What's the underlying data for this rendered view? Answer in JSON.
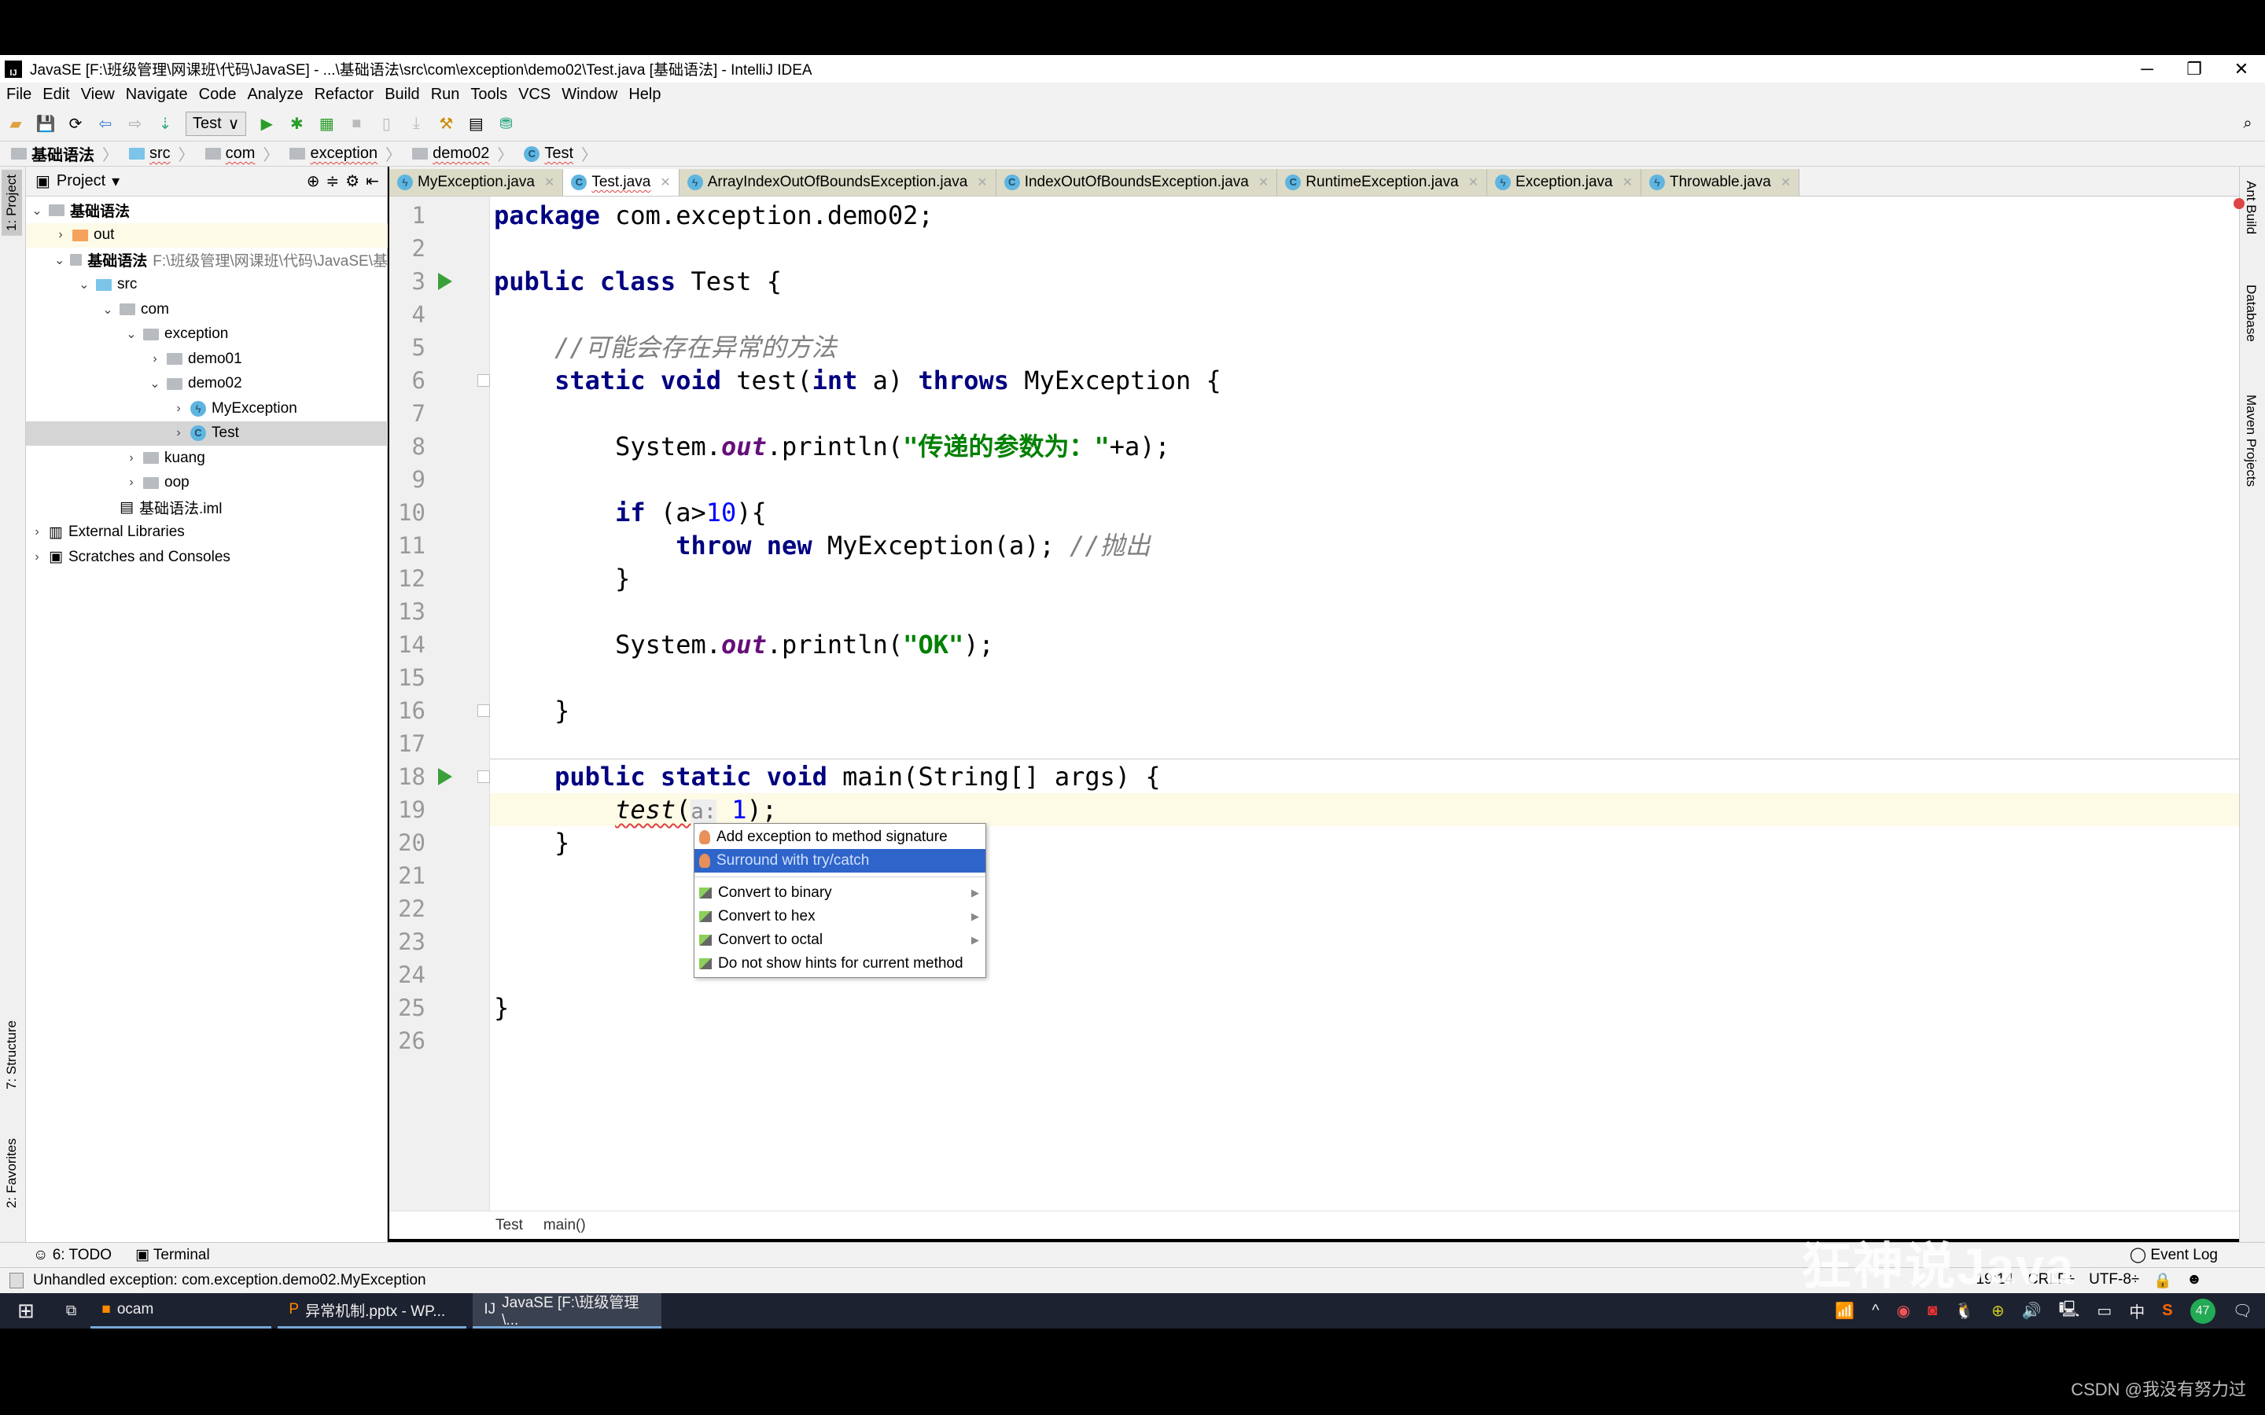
{
  "window": {
    "title": "JavaSE [F:\\班级管理\\网课班\\代码\\JavaSE] - ...\\基础语法\\src\\com\\exception\\demo02\\Test.java [基础语法] - IntelliJ IDEA",
    "logo": "IJ"
  },
  "menu": [
    "File",
    "Edit",
    "View",
    "Navigate",
    "Code",
    "Analyze",
    "Refactor",
    "Build",
    "Run",
    "Tools",
    "VCS",
    "Window",
    "Help"
  ],
  "toolbar": {
    "run_config": "Test"
  },
  "breadcrumbs": [
    "基础语法",
    "src",
    "com",
    "exception",
    "demo02",
    "Test"
  ],
  "left_strip": {
    "project": "1: Project",
    "structure": "7: Structure",
    "favorites": "2: Favorites"
  },
  "project": {
    "header": "Project",
    "tree": [
      {
        "label": "基础语法",
        "icon": "module",
        "depth": 0,
        "open": true
      },
      {
        "label": "out",
        "icon": "folder-orange",
        "depth": 1,
        "open": false
      },
      {
        "label": "基础语法",
        "path": "F:\\班级管理\\网课班\\代码\\JavaSE\\基",
        "icon": "module",
        "depth": 1,
        "open": true
      },
      {
        "label": "src",
        "icon": "folder-blue",
        "depth": 2,
        "open": true
      },
      {
        "label": "com",
        "icon": "package",
        "depth": 3,
        "open": true
      },
      {
        "label": "exception",
        "icon": "package",
        "depth": 4,
        "open": true
      },
      {
        "label": "demo01",
        "icon": "package",
        "depth": 5,
        "open": false
      },
      {
        "label": "demo02",
        "icon": "package",
        "depth": 5,
        "open": true
      },
      {
        "label": "MyException",
        "icon": "exception-class",
        "depth": 6,
        "open": false
      },
      {
        "label": "Test",
        "icon": "class",
        "depth": 6,
        "open": false,
        "selected": true
      },
      {
        "label": "kuang",
        "icon": "package",
        "depth": 4,
        "open": false
      },
      {
        "label": "oop",
        "icon": "package",
        "depth": 4,
        "open": false
      },
      {
        "label": "基础语法.iml",
        "icon": "iml",
        "depth": 3,
        "leaf": true
      },
      {
        "label": "External Libraries",
        "icon": "libraries",
        "depth": 0,
        "open": false
      },
      {
        "label": "Scratches and Consoles",
        "icon": "scratches",
        "depth": 0,
        "open": false
      }
    ]
  },
  "tabs": [
    {
      "label": "MyException.java",
      "icon": "exception-class"
    },
    {
      "label": "Test.java",
      "icon": "class",
      "active": true
    },
    {
      "label": "ArrayIndexOutOfBoundsException.java",
      "icon": "exception-class"
    },
    {
      "label": "IndexOutOfBoundsException.java",
      "icon": "class"
    },
    {
      "label": "RuntimeException.java",
      "icon": "class"
    },
    {
      "label": "Exception.java",
      "icon": "exception-class"
    },
    {
      "label": "Throwable.java",
      "icon": "exception-class"
    }
  ],
  "editor": {
    "lines": [
      [
        [
          "kw",
          "package"
        ],
        [
          "pl",
          " com.exception.demo02;"
        ]
      ],
      [],
      [
        [
          "kw",
          "public class"
        ],
        [
          "pl",
          " Test {"
        ]
      ],
      [],
      [
        [
          "pl",
          "    "
        ],
        [
          "cm",
          "//可能会存在异常的方法"
        ]
      ],
      [
        [
          "pl",
          "    "
        ],
        [
          "kw",
          "static void"
        ],
        [
          "pl",
          " test("
        ],
        [
          "kw",
          "int"
        ],
        [
          "pl",
          " a) "
        ],
        [
          "kw",
          "throws"
        ],
        [
          "pl",
          " MyException {"
        ]
      ],
      [],
      [
        [
          "pl",
          "        System."
        ],
        [
          "fld",
          "out"
        ],
        [
          "pl",
          ".println("
        ],
        [
          "str",
          "\"传递的参数为：\""
        ],
        [
          "pl",
          "+a);"
        ]
      ],
      [],
      [
        [
          "pl",
          "        "
        ],
        [
          "kw",
          "if"
        ],
        [
          "pl",
          " (a>"
        ],
        [
          "num",
          "10"
        ],
        [
          "pl",
          "){"
        ]
      ],
      [
        [
          "pl",
          "            "
        ],
        [
          "kw",
          "throw new"
        ],
        [
          "pl",
          " MyException(a); "
        ],
        [
          "cm",
          "//抛出"
        ]
      ],
      [
        [
          "pl",
          "        }"
        ]
      ],
      [],
      [
        [
          "pl",
          "        System."
        ],
        [
          "fld",
          "out"
        ],
        [
          "pl",
          ".println("
        ],
        [
          "str",
          "\"OK\""
        ],
        [
          "pl",
          ");"
        ]
      ],
      [],
      [
        [
          "pl",
          "    }"
        ]
      ],
      [],
      [
        [
          "pl",
          "    "
        ],
        [
          "kw",
          "public static void"
        ],
        [
          "pl",
          " main(String[] args) {"
        ]
      ],
      [
        [
          "pl",
          "        "
        ],
        [
          "it sq",
          "test"
        ],
        [
          "sq",
          "("
        ],
        [
          "hint",
          "a:"
        ],
        [
          "num sq",
          " 1"
        ],
        [
          "sq",
          ")"
        ],
        [
          "pl",
          ";"
        ]
      ],
      [
        [
          "pl",
          "    }"
        ]
      ],
      [],
      [],
      [],
      [],
      [
        [
          "pl",
          "}"
        ]
      ],
      []
    ],
    "caret_line": 19,
    "run_markers": [
      3,
      18
    ],
    "bottom_crumbs": [
      "Test",
      "main()"
    ]
  },
  "intention_popup": {
    "items": [
      {
        "label": "Add exception to method signature",
        "icon": "bulb-icon"
      },
      {
        "label": "Surround with try/catch",
        "icon": "bulb-icon",
        "selected": true
      },
      {
        "label": "Convert to binary",
        "icon": "intention-icon",
        "submenu": true
      },
      {
        "label": "Convert to hex",
        "icon": "intention-icon",
        "submenu": true
      },
      {
        "label": "Convert to octal",
        "icon": "intention-icon",
        "submenu": true
      },
      {
        "label": "Do not show hints for current method",
        "icon": "intention-icon"
      }
    ]
  },
  "right_strip": [
    "Ant Build",
    "Database",
    "Maven Projects"
  ],
  "bottom_tools": {
    "todo": "6: TODO",
    "terminal": "Terminal",
    "event_log": "Event Log"
  },
  "status": {
    "message": "Unhandled exception: com.exception.demo02.MyException",
    "position": "19:14",
    "line_sep": "CRLF÷",
    "encoding": "UTF-8÷"
  },
  "taskbar": {
    "apps": [
      "ocam",
      "异常机制.pptx - WP...",
      "JavaSE [F:\\班级管理\\..."
    ],
    "tray_ime": "中",
    "tray_badge": "47"
  },
  "overlay_text": "狂神说Java",
  "watermark": "CSDN @我没有努力过"
}
